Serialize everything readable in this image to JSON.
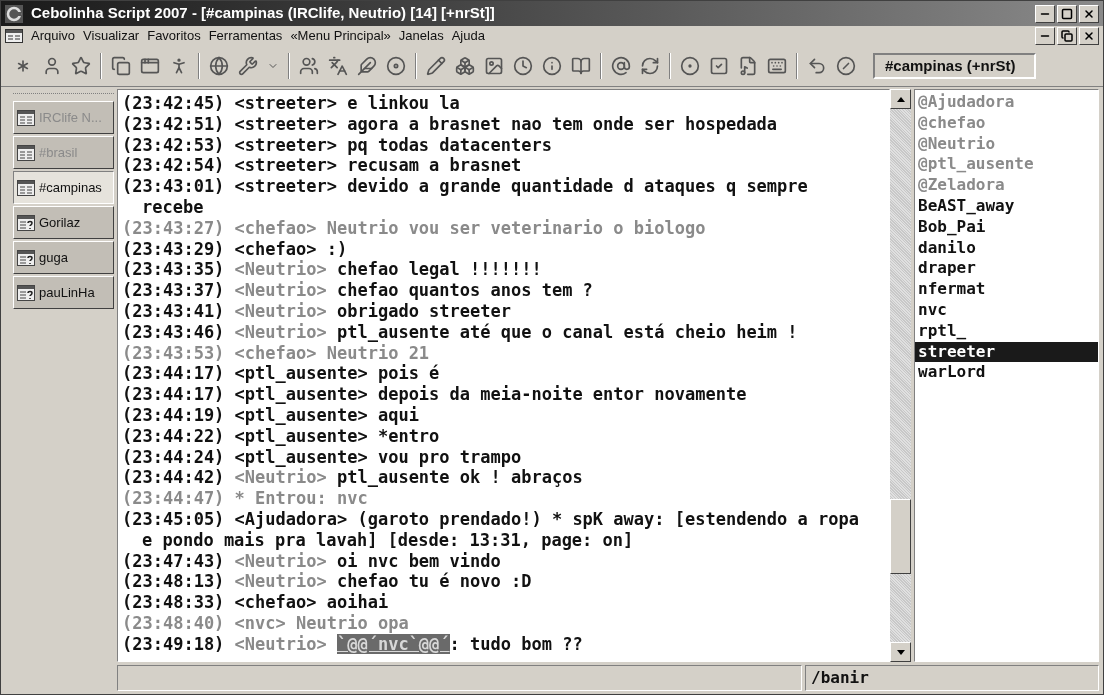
{
  "window": {
    "title": "Cebolinha Script 2007 - [#campinas (IRClife, Neutrio) [14] [+nrSt]]"
  },
  "menu": [
    "Arquivo",
    "Visualizar",
    "Favoritos",
    "Ferramentas",
    "«Menu Principal»",
    "Janelas",
    "Ajuda"
  ],
  "channel_box": "#campinas (+nrSt)",
  "sidebar": {
    "items": [
      {
        "label": "IRClife N...",
        "kind": "status",
        "selected": false,
        "dimmed": true
      },
      {
        "label": "#brasil",
        "kind": "channel",
        "selected": false,
        "dimmed": true
      },
      {
        "label": "#campinas",
        "kind": "channel",
        "selected": true,
        "dimmed": false
      },
      {
        "label": "Gorilaz",
        "kind": "query",
        "selected": false,
        "dimmed": false
      },
      {
        "label": "guga",
        "kind": "query",
        "selected": false,
        "dimmed": false
      },
      {
        "label": "pauLinHa",
        "kind": "query",
        "selected": false,
        "dimmed": false
      }
    ]
  },
  "chat": [
    {
      "kind": "message",
      "time": "(23:42:45)",
      "nick": "<streeter>",
      "text": "e linkou la",
      "muted": false,
      "nick_muted": false
    },
    {
      "kind": "message",
      "time": "(23:42:51)",
      "nick": "<streeter>",
      "text": "agora a brasnet nao tem onde ser hospedada",
      "muted": false,
      "nick_muted": false
    },
    {
      "kind": "message",
      "time": "(23:42:53)",
      "nick": "<streeter>",
      "text": "pq todas datacenters",
      "muted": false,
      "nick_muted": false
    },
    {
      "kind": "message",
      "time": "(23:42:54)",
      "nick": "<streeter>",
      "text": "recusam a brasnet",
      "muted": false,
      "nick_muted": false
    },
    {
      "kind": "message",
      "time": "(23:43:01)",
      "nick": "<streeter>",
      "text": "devido a grande quantidade d ataques q sempre",
      "continuation": "recebe",
      "muted": false,
      "nick_muted": false
    },
    {
      "kind": "message",
      "time": "(23:43:27)",
      "nick": "<chefao>",
      "text": "Neutrio vou ser veterinario o biologo",
      "muted": true,
      "nick_muted": true
    },
    {
      "kind": "message",
      "time": "(23:43:29)",
      "nick": "<chefao>",
      "text": ":)",
      "muted": false,
      "nick_muted": false
    },
    {
      "kind": "message",
      "time": "(23:43:35)",
      "nick": "<Neutrio>",
      "text": "chefao legal !!!!!!!",
      "muted": false,
      "nick_muted": true
    },
    {
      "kind": "message",
      "time": "(23:43:37)",
      "nick": "<Neutrio>",
      "text": "chefao quantos anos tem ?",
      "muted": false,
      "nick_muted": true
    },
    {
      "kind": "message",
      "time": "(23:43:41)",
      "nick": "<Neutrio>",
      "text": "obrigado streeter",
      "muted": false,
      "nick_muted": true
    },
    {
      "kind": "message",
      "time": "(23:43:46)",
      "nick": "<Neutrio>",
      "text": "ptl_ausente até que o canal está cheio heim !",
      "muted": false,
      "nick_muted": true
    },
    {
      "kind": "message",
      "time": "(23:43:53)",
      "nick": "<chefao>",
      "text": "Neutrio 21",
      "muted": true,
      "nick_muted": true
    },
    {
      "kind": "message",
      "time": "(23:44:17)",
      "nick": "<ptl_ausente>",
      "text": "pois é",
      "muted": false,
      "nick_muted": false
    },
    {
      "kind": "message",
      "time": "(23:44:17)",
      "nick": "<ptl_ausente>",
      "text": "depois da meia-noite entor novamente",
      "muted": false,
      "nick_muted": false
    },
    {
      "kind": "message",
      "time": "(23:44:19)",
      "nick": "<ptl_ausente>",
      "text": "aqui",
      "muted": false,
      "nick_muted": false
    },
    {
      "kind": "message",
      "time": "(23:44:22)",
      "nick": "<ptl_ausente>",
      "text": "*entro",
      "muted": false,
      "nick_muted": false
    },
    {
      "kind": "message",
      "time": "(23:44:24)",
      "nick": "<ptl_ausente>",
      "text": "vou pro trampo",
      "muted": false,
      "nick_muted": false
    },
    {
      "kind": "message",
      "time": "(23:44:42)",
      "nick": "<Neutrio>",
      "text": "ptl_ausente ok ! abraços",
      "muted": false,
      "nick_muted": true
    },
    {
      "kind": "event",
      "time": "(23:44:47)",
      "text": "* Entrou: nvc",
      "muted": true
    },
    {
      "kind": "message",
      "time": "(23:45:05)",
      "nick": "<Ajudadora>",
      "text": "(garoto prendado!) * spK away: [estendendo a ropa",
      "continuation": "e pondo mais pra lavah] [desde: 13:31, page: on]",
      "muted": false,
      "nick_muted": false
    },
    {
      "kind": "message",
      "time": "(23:47:43)",
      "nick": "<Neutrio>",
      "text": "oi nvc bem vindo",
      "muted": false,
      "nick_muted": true
    },
    {
      "kind": "message",
      "time": "(23:48:13)",
      "nick": "<Neutrio>",
      "text": "chefao tu é novo :D",
      "muted": false,
      "nick_muted": true
    },
    {
      "kind": "message",
      "time": "(23:48:33)",
      "nick": "<chefao>",
      "text": "aoihai",
      "muted": false,
      "nick_muted": false
    },
    {
      "kind": "message",
      "time": "(23:48:40)",
      "nick": "<nvc>",
      "text": "Neutrio opa",
      "muted": true,
      "nick_muted": true
    },
    {
      "kind": "mention",
      "time": "(23:49:18)",
      "nick": "<Neutrio>",
      "highlight": "`@@´nvc`@@´",
      "text": ": tudo bom ??",
      "muted": false,
      "nick_muted": true
    }
  ],
  "nicklist": [
    {
      "nick": "@Ajudadora",
      "op": true,
      "selected": false
    },
    {
      "nick": "@chefao",
      "op": true,
      "selected": false
    },
    {
      "nick": "@Neutrio",
      "op": true,
      "selected": false
    },
    {
      "nick": "@ptl_ausente",
      "op": true,
      "selected": false
    },
    {
      "nick": "@Zeladora",
      "op": true,
      "selected": false
    },
    {
      "nick": "BeAST_away",
      "op": false,
      "selected": false
    },
    {
      "nick": "Bob_Pai",
      "op": false,
      "selected": false
    },
    {
      "nick": "danilo",
      "op": false,
      "selected": false
    },
    {
      "nick": "draper",
      "op": false,
      "selected": false
    },
    {
      "nick": "nfermat",
      "op": false,
      "selected": false
    },
    {
      "nick": "nvc",
      "op": false,
      "selected": false
    },
    {
      "nick": "rptl_",
      "op": false,
      "selected": false
    },
    {
      "nick": "streeter",
      "op": false,
      "selected": true
    },
    {
      "nick": "warLord",
      "op": false,
      "selected": false
    }
  ],
  "status_bar": {
    "command": "/banir"
  }
}
